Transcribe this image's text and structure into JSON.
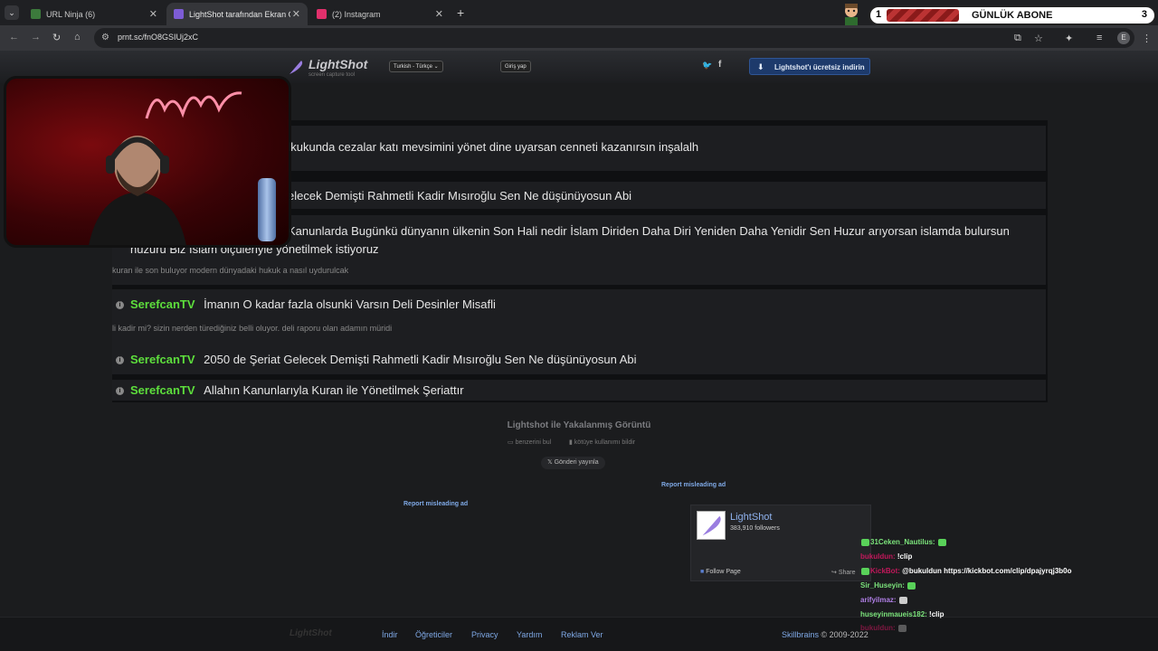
{
  "browser": {
    "tabs": [
      {
        "label": "URL Ninja (6)",
        "favicon_color": "#3c7a3c"
      },
      {
        "label": "LightShot tarafından Ekran Gör",
        "favicon_color": "#7d5cd6"
      },
      {
        "label": "(2) Instagram",
        "favicon_color": "#e1306c"
      }
    ],
    "url": "prnt.sc/fnO8GSIUj2xC"
  },
  "widget": {
    "count": "1",
    "label": "GÜNLÜK ABONE",
    "goal": "3"
  },
  "lightshot": {
    "logo": "LightShot",
    "tagline": "screen capture tool",
    "language": "Turkish - Türkçe",
    "login": "Giriş yap",
    "download": "Lightshot'ı ücretsiz indirin"
  },
  "messages": [
    {
      "user": "",
      "text": "ukukunda cezalar katı mevsimini yönet dine uyarsan cenneti kazanırsın inşalalh"
    },
    {
      "user": "",
      "text": "elecek Demişti Rahmetli Kadir Mısıroğlu Sen Ne düşünüyosun Abi"
    },
    {
      "user": "",
      "text": "Kanunlarda Bugünkü dünyanın ülkenin Son Hali nedir İslam Diriden Daha Diri Yeniden Daha Yenidir Sen Huzur arıyorsan islamda bulursun",
      "text2": "huzuru Biz İslam ölçüleriyle yönetilmek istiyoruz",
      "sub": "kuran ile son buluyor modern dünyadaki hukuk a nasıl uydurulcak"
    },
    {
      "user": "SerefcanTV",
      "text": "İmanın O kadar fazla olsunki Varsın Deli Desinler Misafli",
      "sub": "li kadir mi? sizin nerden türediğiniz belli oluyor. deli raporu olan adamın müridi"
    },
    {
      "user": "SerefcanTV",
      "text": "2050 de Şeriat Gelecek Demişti Rahmetli Kadir Mısıroğlu Sen Ne düşünüyosun Abi"
    },
    {
      "user": "SerefcanTV",
      "text": "Allahın Kanunlarıyla Kuran ile Yönetilmek Şeriattır"
    }
  ],
  "below": {
    "title": "Lightshot ile Yakalanmış Görüntü",
    "find_similar": "benzerini bul",
    "report_abuse": "kötüye kullanımı bildir",
    "post": "Gönderi yayınla",
    "misleading": "Report misleading ad"
  },
  "fb": {
    "name": "LightShot",
    "followers": "383,910 followers",
    "follow": "Follow Page",
    "share": "Share"
  },
  "footer": {
    "logo": "LightShot",
    "links": [
      "İndir",
      "Öğreticiler",
      "Privacy",
      "Yardım",
      "Reklam Ver"
    ],
    "brand": "Skillbrains",
    "copyright": "© 2009-2022"
  },
  "chat": [
    {
      "user": "31Ceken_Nautilus:",
      "color": "#7be37b",
      "text": ""
    },
    {
      "user": "bukuldun:",
      "color": "#c2185b",
      "text": "!clip"
    },
    {
      "user": "KickBot:",
      "color": "#c2185b",
      "text": "@bukuldun https://kickbot.com/clip/dpajyrqj3b0o"
    },
    {
      "user": "Sir_Huseyin:",
      "color": "#7be37b",
      "text": ""
    },
    {
      "user": "arifyilmaz:",
      "color": "#b07fe6",
      "text": ""
    },
    {
      "user": "huseyinmaueis182:",
      "color": "#7be37b",
      "text": "!clip"
    },
    {
      "user": "bukuldun:",
      "color": "#c2185b",
      "text": ""
    }
  ]
}
